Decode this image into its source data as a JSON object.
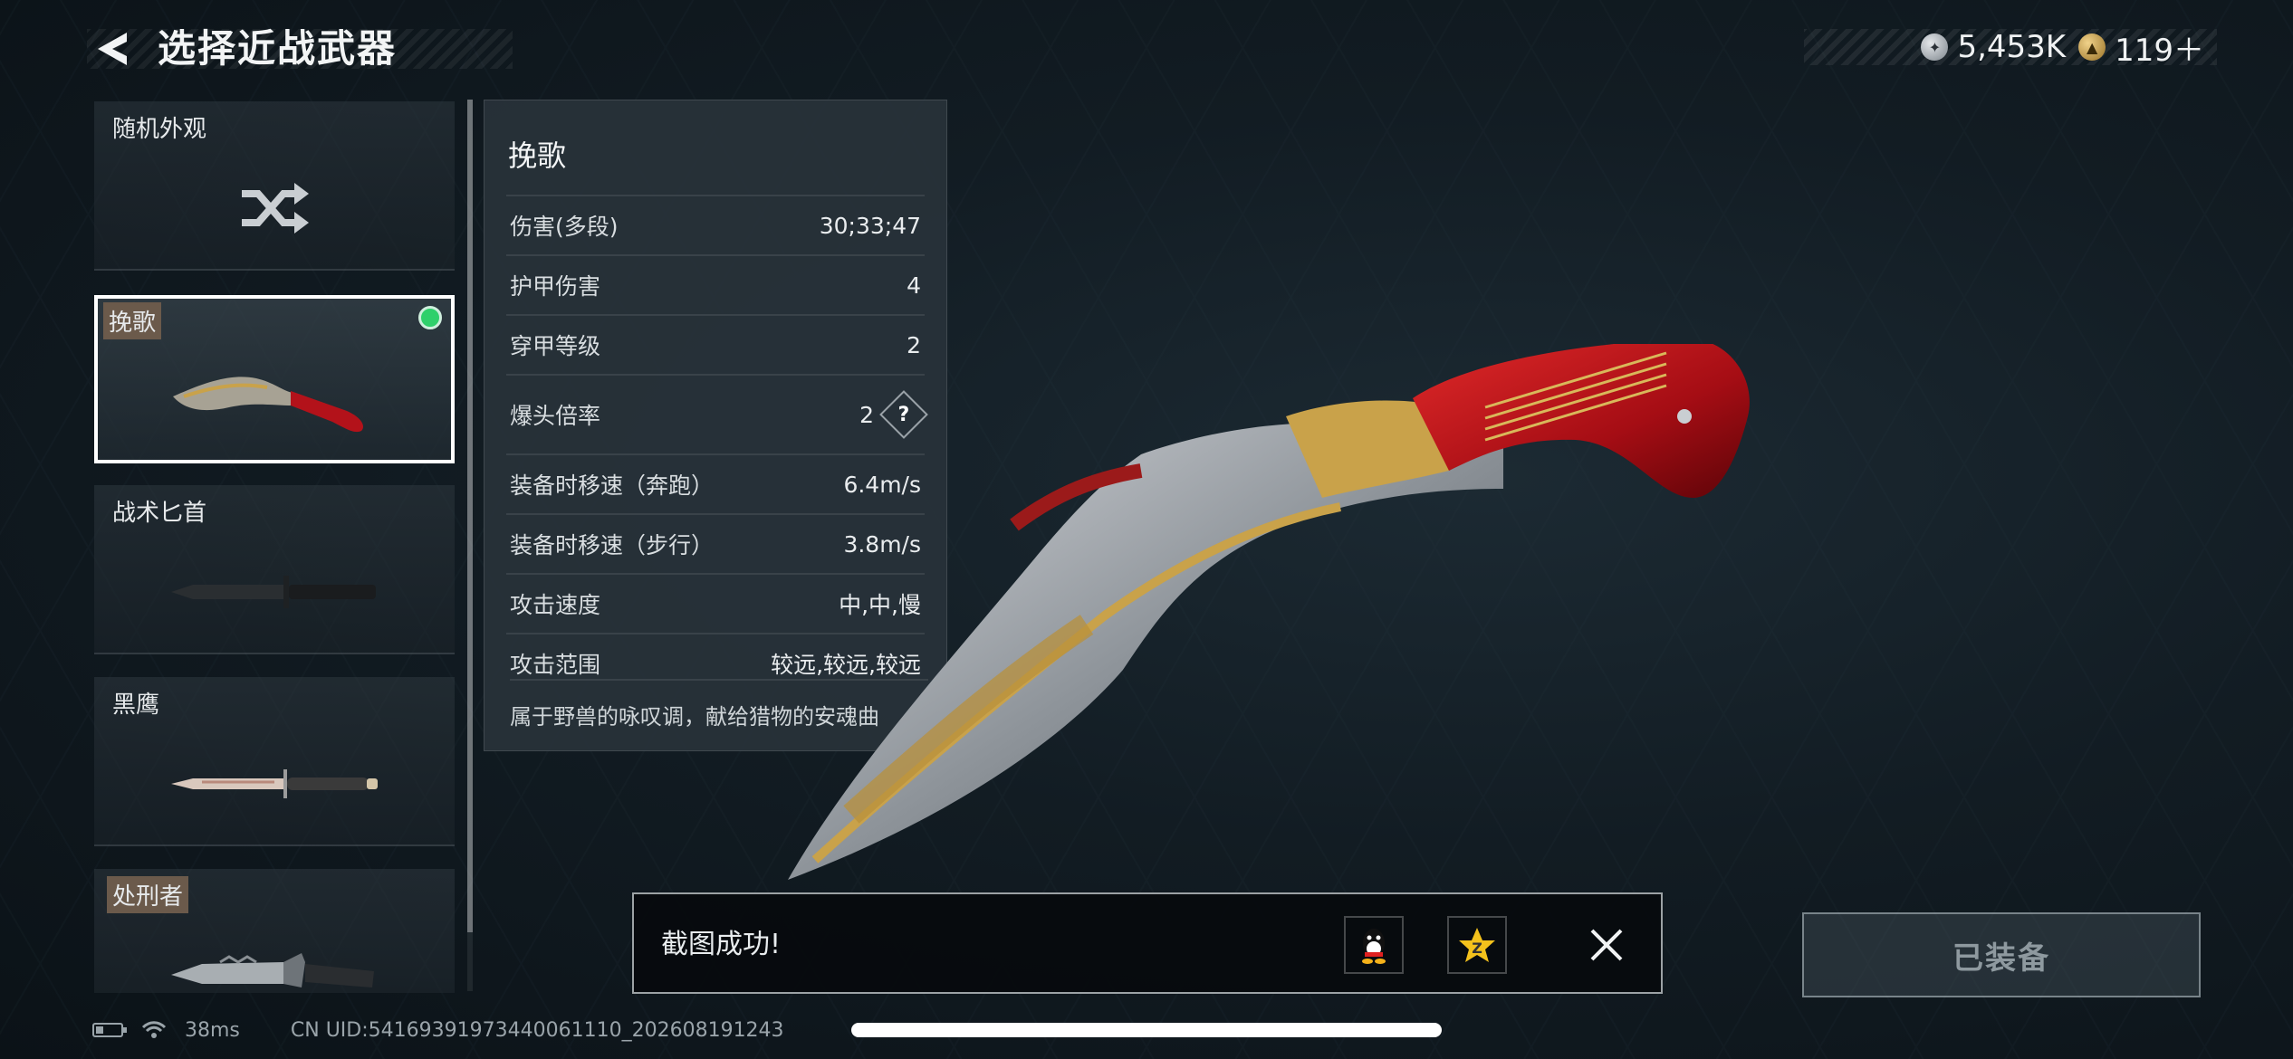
{
  "header": {
    "title": "选择近战武器",
    "back_icon": "back-arrow-icon"
  },
  "currency": [
    {
      "icon": "silver-coin-icon",
      "value": "5,453K"
    },
    {
      "icon": "gold-coin-icon",
      "value": "119＋"
    }
  ],
  "weapons": [
    {
      "name": "随机外观",
      "icon": "shuffle-icon",
      "selected": false
    },
    {
      "name": "挽歌",
      "icon": "kukri-knife-icon",
      "selected": true,
      "equipped": true
    },
    {
      "name": "战术匕首",
      "icon": "tactical-knife-icon",
      "selected": false
    },
    {
      "name": "黑鹰",
      "icon": "combat-knife-icon",
      "selected": false
    },
    {
      "name": "处刑者",
      "icon": "serrated-knife-icon",
      "selected": false
    }
  ],
  "stats": {
    "title": "挽歌",
    "rows": [
      {
        "label": "伤害(多段)",
        "value": "30;33;47"
      },
      {
        "label": "护甲伤害",
        "value": "4"
      },
      {
        "label": "穿甲等级",
        "value": "2"
      },
      {
        "label": "爆头倍率",
        "value": "2",
        "help": "?"
      },
      {
        "label": "装备时移速（奔跑）",
        "value": "6.4m/s"
      },
      {
        "label": "装备时移速（步行）",
        "value": "3.8m/s"
      },
      {
        "label": "攻击速度",
        "value": "中,中,慢"
      },
      {
        "label": "攻击范围",
        "value": "较远,较远,较远"
      }
    ],
    "description": "属于野兽的咏叹调，献给猎物的安魂曲"
  },
  "toast": {
    "message": "截图成功!",
    "share_icons": [
      "qq-icon",
      "qzone-icon"
    ],
    "close_icon": "close-icon"
  },
  "equip_button": "已装备",
  "footer": {
    "ping": "38ms",
    "uid": "CN UID:54169391973440061110_202608191243"
  },
  "colors": {
    "equipped_dot": "#2fd06b",
    "blade_red": "#b3121a",
    "gold": "#c9a24a"
  }
}
